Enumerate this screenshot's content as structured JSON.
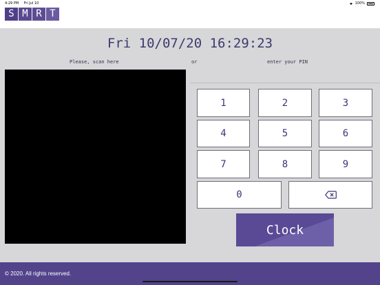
{
  "status_bar": {
    "time": "4:29 PM",
    "date": "Fri Jul 10",
    "battery": "100%"
  },
  "brand": {
    "letters": [
      "S",
      "M",
      "R",
      "T"
    ],
    "color": "#56458c"
  },
  "datetime": "Fri 10/07/20 16:29:23",
  "hints": {
    "scan": "Please, scan here",
    "or": "or",
    "pin": "enter your PIN"
  },
  "keypad": {
    "keys": [
      "1",
      "2",
      "3",
      "4",
      "5",
      "6",
      "7",
      "8",
      "9",
      "0"
    ],
    "backspace_icon": "backspace-icon"
  },
  "clock_button": "Clock",
  "footer": {
    "copyright": "© 2020. All rights reserved."
  },
  "colors": {
    "accent": "#56458c",
    "background": "#d7d7d9"
  }
}
